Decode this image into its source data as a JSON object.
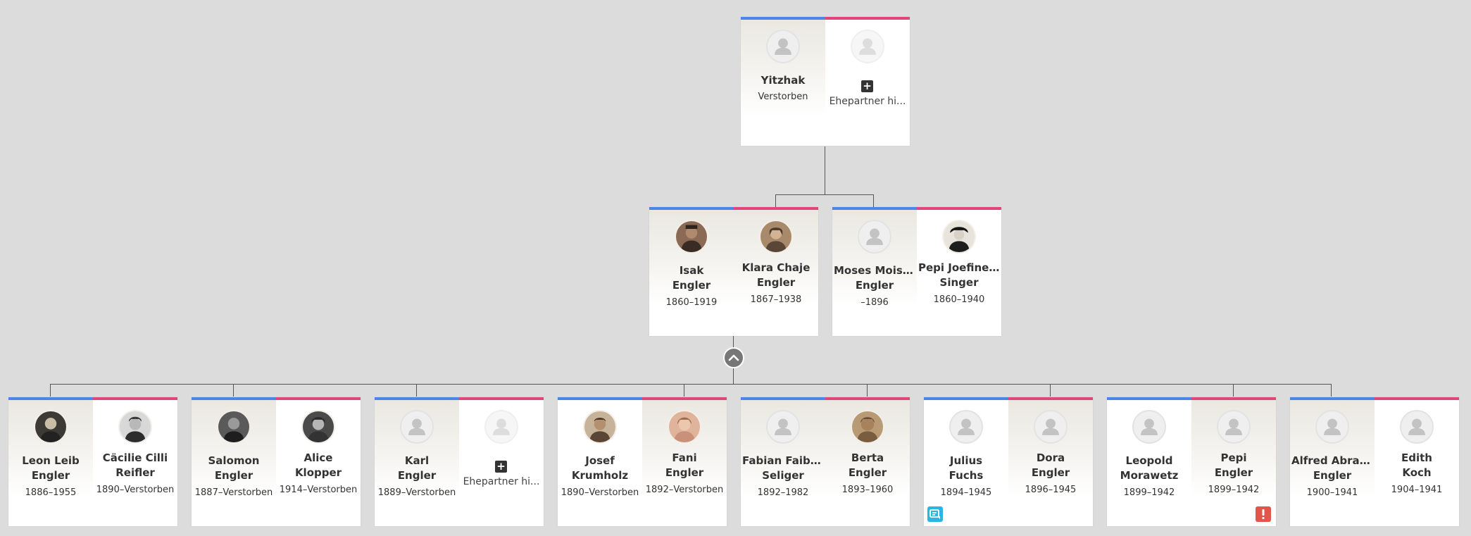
{
  "top": {
    "left": {
      "name": "Yitzhak",
      "dates": "Verstorben"
    },
    "right": {
      "add_label": "Ehepartner hi..."
    }
  },
  "gen2": [
    {
      "left": {
        "name_lines": [
          "Isak",
          "Engler"
        ],
        "dates": "1860–1919"
      },
      "right": {
        "name_lines": [
          "Klara Chaje",
          "Engler"
        ],
        "dates": "1867–1938"
      }
    },
    {
      "left": {
        "name_lines": [
          "Moses Moish...",
          "Engler"
        ],
        "dates": "–1896"
      },
      "right": {
        "name_lines": [
          "Pepi Joefine ...",
          "Singer"
        ],
        "dates": "1860–1940"
      }
    }
  ],
  "gen3": [
    {
      "left": {
        "name_lines": [
          "Leon Leib",
          "Engler"
        ],
        "dates": "1886–1955"
      },
      "right": {
        "name_lines": [
          "Cäcilie Cilli",
          "Reifler"
        ],
        "dates": "1890–Verstorben"
      }
    },
    {
      "left": {
        "name_lines": [
          "Salomon",
          "Engler"
        ],
        "dates": "1887–Verstorben"
      },
      "right": {
        "name_lines": [
          "Alice",
          "Klopper"
        ],
        "dates": "1914–Verstorben"
      }
    },
    {
      "left": {
        "name_lines": [
          "Karl",
          "Engler"
        ],
        "dates": "1889–Verstorben"
      },
      "right": {
        "add_label": "Ehepartner hi..."
      }
    },
    {
      "left": {
        "name_lines": [
          "Josef",
          "Krumholz"
        ],
        "dates": "1890–Verstorben"
      },
      "right": {
        "name_lines": [
          "Fani",
          "Engler"
        ],
        "dates": "1892–Verstorben"
      }
    },
    {
      "left": {
        "name_lines": [
          "Fabian Faibis...",
          "Seliger"
        ],
        "dates": "1892–1982"
      },
      "right": {
        "name_lines": [
          "Berta",
          "Engler"
        ],
        "dates": "1893–1960"
      }
    },
    {
      "left": {
        "name_lines": [
          "Julius",
          "Fuchs"
        ],
        "dates": "1894–1945"
      },
      "right": {
        "name_lines": [
          "Dora",
          "Engler"
        ],
        "dates": "1896–1945"
      }
    },
    {
      "left": {
        "name_lines": [
          "Leopold",
          "Morawetz"
        ],
        "dates": "1899–1942"
      },
      "right": {
        "name_lines": [
          "Pepi",
          "Engler"
        ],
        "dates": "1899–1942"
      }
    },
    {
      "left": {
        "name_lines": [
          "Alfred Abrah...",
          "Engler"
        ],
        "dates": "1900–1941"
      },
      "right": {
        "name_lines": [
          "Edith",
          "Koch"
        ],
        "dates": "1904–1941"
      }
    }
  ],
  "colors": {
    "background": "#dcdcdc",
    "male_bar": "#4a86e8",
    "female_bar": "#e0457b",
    "connector": "#555555",
    "collapse_button": "#777777",
    "record_badge": "#29b6e0",
    "alert_badge": "#e2554a"
  },
  "icons": {
    "collapse": "chevron-up-icon",
    "add_spouse": "plus-square-icon",
    "record": "record-match-icon",
    "alert": "exclamation-icon",
    "avatar_placeholder": "person-silhouette-icon"
  }
}
